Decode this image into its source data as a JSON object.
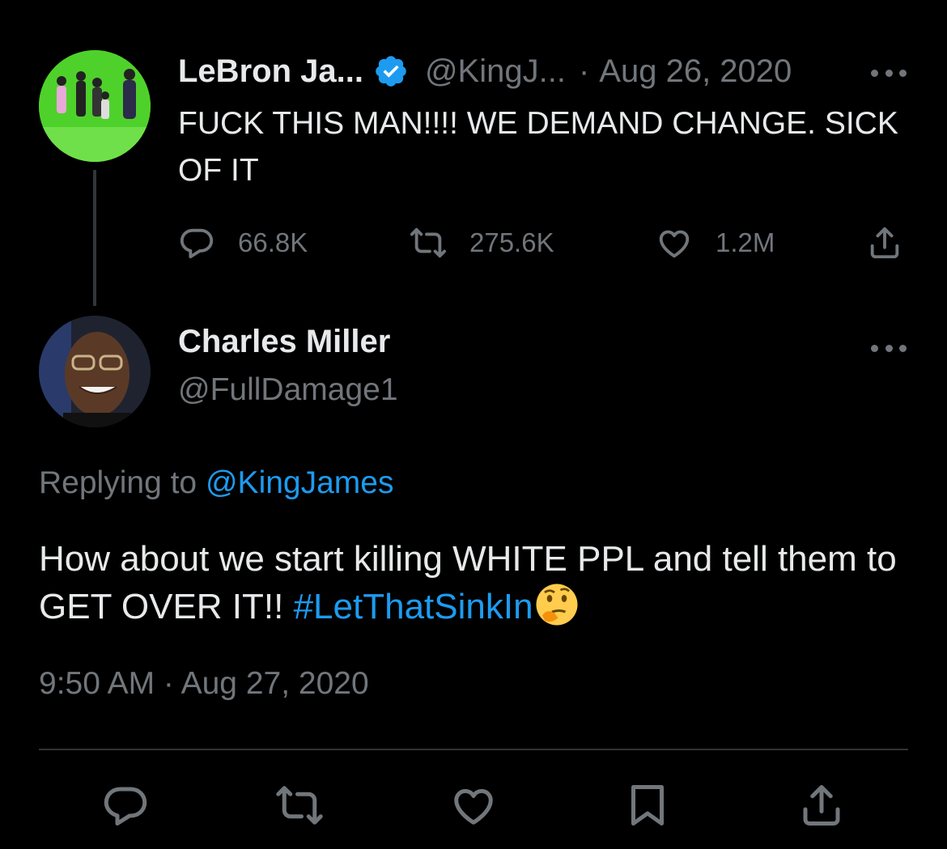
{
  "parent_tweet": {
    "author_name": "LeBron Ja...",
    "author_handle": "@KingJ...",
    "separator": "·",
    "date": "Aug 26, 2020",
    "text": "FUCK THIS MAN!!!! WE DEMAND CHANGE. SICK OF IT",
    "stats": {
      "replies": "66.8K",
      "retweets": "275.6K",
      "likes": "1.2M"
    }
  },
  "reply_tweet": {
    "author_name": "Charles Miller",
    "author_handle": "@FullDamage1",
    "replying_prefix": "Replying to",
    "replying_mention": "@KingJames",
    "text_main": "How about we start killing WHITE PPL and tell them to GET OVER IT!! ",
    "hashtag": "#LetThatSinkIn",
    "emoji": "thinking-face",
    "timestamp": "9:50 AM · Aug 27, 2020"
  },
  "icons": {
    "verified": "verified-badge-icon",
    "more": "more-icon",
    "reply": "reply-icon",
    "retweet": "retweet-icon",
    "like": "heart-icon",
    "share": "share-icon",
    "bookmark": "bookmark-icon"
  },
  "colors": {
    "background": "#000000",
    "text_primary": "#e7e9ea",
    "text_secondary": "#71767b",
    "accent": "#1d9bf0",
    "divider": "#2f3336"
  }
}
